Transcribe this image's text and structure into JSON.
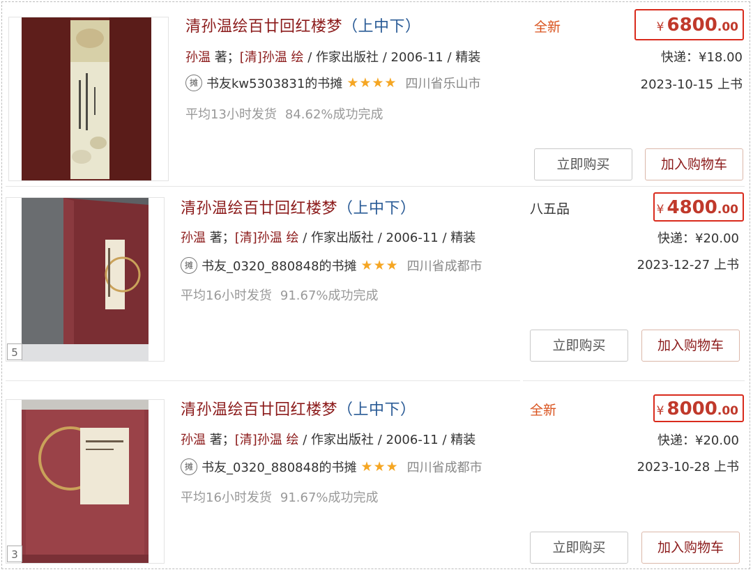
{
  "listings": [
    {
      "title_main": "清孙温绘百廿回红楼梦",
      "title_sub": "（上中下）",
      "author": "孙温",
      "author_role": " 著；",
      "illustrator": "[清]孙温",
      "illustrator_role": " 绘",
      "publisher_info": " / 作家出版社 / 2006-11 / 精装",
      "stall_icon": "摊",
      "stall_name": "书友kw5303831的书摊",
      "stars": "★★★★",
      "location": "四川省乐山市",
      "avg_ship": "平均13小时发货",
      "success_rate": "84.62%成功完成",
      "condition": "全新",
      "condition_color": "#d9531e",
      "currency": "¥",
      "price_int": "6800",
      "price_dec": ".00",
      "shipping": "快递：¥18.00",
      "listed_date": "2023-10-15 上书",
      "buy_label": "立即购买",
      "cart_label": "加入购物车",
      "image_count": ""
    },
    {
      "title_main": "清孙温绘百廿回红楼梦",
      "title_sub": "（上中下）",
      "author": "孙温",
      "author_role": " 著；",
      "illustrator": "[清]孙温",
      "illustrator_role": " 绘",
      "publisher_info": " / 作家出版社 / 2006-11 / 精装",
      "stall_icon": "摊",
      "stall_name": "书友_0320_880848的书摊",
      "stars": "★★★",
      "location": "四川省成都市",
      "avg_ship": "平均16小时发货",
      "success_rate": "91.67%成功完成",
      "condition": "八五品",
      "condition_color": "#333333",
      "currency": "¥",
      "price_int": "4800",
      "price_dec": ".00",
      "shipping": "快递：¥20.00",
      "listed_date": "2023-12-27 上书",
      "buy_label": "立即购买",
      "cart_label": "加入购物车",
      "image_count": "5"
    },
    {
      "title_main": "清孙温绘百廿回红楼梦",
      "title_sub": "（上中下）",
      "author": "孙温",
      "author_role": " 著；",
      "illustrator": "[清]孙温",
      "illustrator_role": " 绘",
      "publisher_info": " / 作家出版社 / 2006-11 / 精装",
      "stall_icon": "摊",
      "stall_name": "书友_0320_880848的书摊",
      "stars": "★★★",
      "location": "四川省成都市",
      "avg_ship": "平均16小时发货",
      "success_rate": "91.67%成功完成",
      "condition": "全新",
      "condition_color": "#d9531e",
      "currency": "¥",
      "price_int": "8000",
      "price_dec": ".00",
      "shipping": "快递：¥20.00",
      "listed_date": "2023-10-28 上书",
      "buy_label": "立即购买",
      "cart_label": "加入购物车",
      "image_count": "3"
    }
  ]
}
